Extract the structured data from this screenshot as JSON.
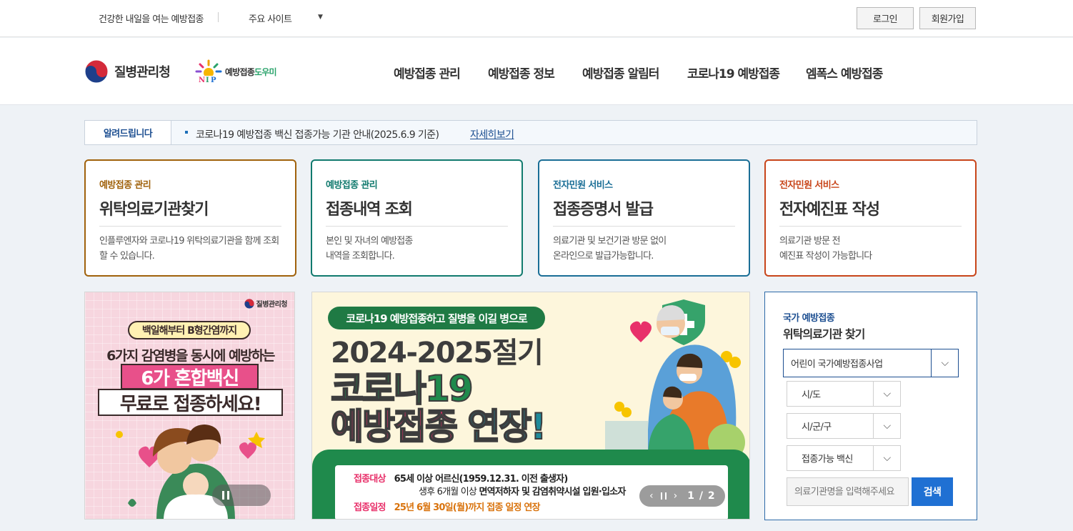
{
  "topbar": {
    "slogan": "건강한 내일을 여는 예방접종",
    "sites_label": "주요 사이트",
    "sites_caret": "▼",
    "login": "로그인",
    "join": "회원가입"
  },
  "header": {
    "kdca_name": "질병관리청",
    "nip_name_a": "예방접종",
    "nip_name_b": "도우미",
    "nav": [
      "예방접종 관리",
      "예방접종 정보",
      "예방접종 알림터",
      "코로나19 예방접종",
      "엠폭스 예방접종"
    ]
  },
  "notice": {
    "label": "알려드립니다",
    "text": "코로나19 예방접종 백신 접종가능 기관 안내(2025.6.9 기준)",
    "more": "자세히보기"
  },
  "cards": [
    {
      "category": "예방접종 관리",
      "title": "위탁의료기관찾기",
      "desc": "인플루엔자와 코로나19 위탁의료기관을 함께 조회할 수 있습니다.",
      "color": "#a0620c"
    },
    {
      "category": "예방접종 관리",
      "title": "접종내역 조회",
      "desc": "본인 및 자녀의 예방접종\n내역을 조회합니다.",
      "color": "#117a6e"
    },
    {
      "category": "전자민원 서비스",
      "title": "접종증명서 발급",
      "desc": "의료기관 및 보건기관 방문 없이\n온라인으로 발급가능합니다.",
      "color": "#1a6e96"
    },
    {
      "category": "전자민원 서비스",
      "title": "전자예진표 작성",
      "desc": "의료기관 방문 전\n예진표 작성이 가능합니다",
      "color": "#c8451a"
    }
  ],
  "banner_left": {
    "org": "질병관리청",
    "pill": "백일해부터 B형간염까지",
    "line2": "6가지 감염병을 동시에 예방하는",
    "line3": "6가 혼합백신",
    "line4": "무료로 접종하세요!"
  },
  "banner_center": {
    "pill": "코로나19 예방접종하고 질병을 이길 병으로",
    "year": "2024-2025절기",
    "covid": "코로나19",
    "ext_a": "예방접종",
    "ext_b": "연장!",
    "row1_tag": "접종대상",
    "row1_text": "65세 이상 어르신(1959.12.31. 이전 출생자)",
    "row2_a": "생후 6개월 이상 ",
    "row2_b": "면역저하자 및 감염취약시설 입원·입소자",
    "row3_tag": "접종일정",
    "row3_text": "25년 6월 30일(월)까지 접종 일정 연장",
    "counter": "1 / 2",
    "prev": "‹",
    "next": "›"
  },
  "search": {
    "subtitle": "국가 예방접종",
    "title": "위탁의료기관 찾기",
    "program": "어린이 국가예방접종사업",
    "sido": "시/도",
    "sigungu": "시/군/구",
    "vaccine": "접종가능 백신",
    "placeholder": "의료기관명을 입력해주세요",
    "button": "검색",
    "arrow": "⌵"
  },
  "colors": {
    "brand_blue": "#1d4f91",
    "search_button": "#1f70d3"
  }
}
